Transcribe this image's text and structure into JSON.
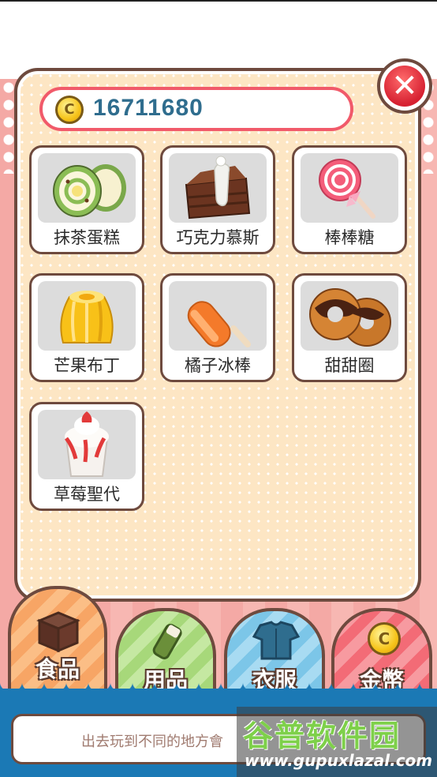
{
  "coins": {
    "amount": "16711680",
    "coin_symbol": "C"
  },
  "close_button": {
    "symbol": "✕"
  },
  "items": [
    {
      "label": "抹茶蛋糕",
      "icon": "matcha-roll-cake-icon"
    },
    {
      "label": "巧克力慕斯",
      "icon": "chocolate-mousse-icon"
    },
    {
      "label": "棒棒糖",
      "icon": "lollipop-icon"
    },
    {
      "label": "芒果布丁",
      "icon": "mango-pudding-icon"
    },
    {
      "label": "橘子冰棒",
      "icon": "orange-popsicle-icon"
    },
    {
      "label": "甜甜圈",
      "icon": "donut-icon"
    },
    {
      "label": "草莓聖代",
      "icon": "strawberry-sundae-icon"
    }
  ],
  "tabs": [
    {
      "label": "食品",
      "icon": "food-box-icon",
      "color": "#f7a565",
      "selected": true
    },
    {
      "label": "用品",
      "icon": "goods-bottle-icon",
      "color": "#a7d87a",
      "selected": false
    },
    {
      "label": "衣服",
      "icon": "shirt-icon",
      "color": "#7cc6e8",
      "selected": false
    },
    {
      "label": "金幣",
      "icon": "coin-icon",
      "color": "#f36b76",
      "selected": false
    }
  ],
  "message": {
    "text": "出去玩到不同的地方會"
  },
  "watermark": {
    "title": "谷普软件园",
    "url": "www.gupuxlazal.com"
  }
}
